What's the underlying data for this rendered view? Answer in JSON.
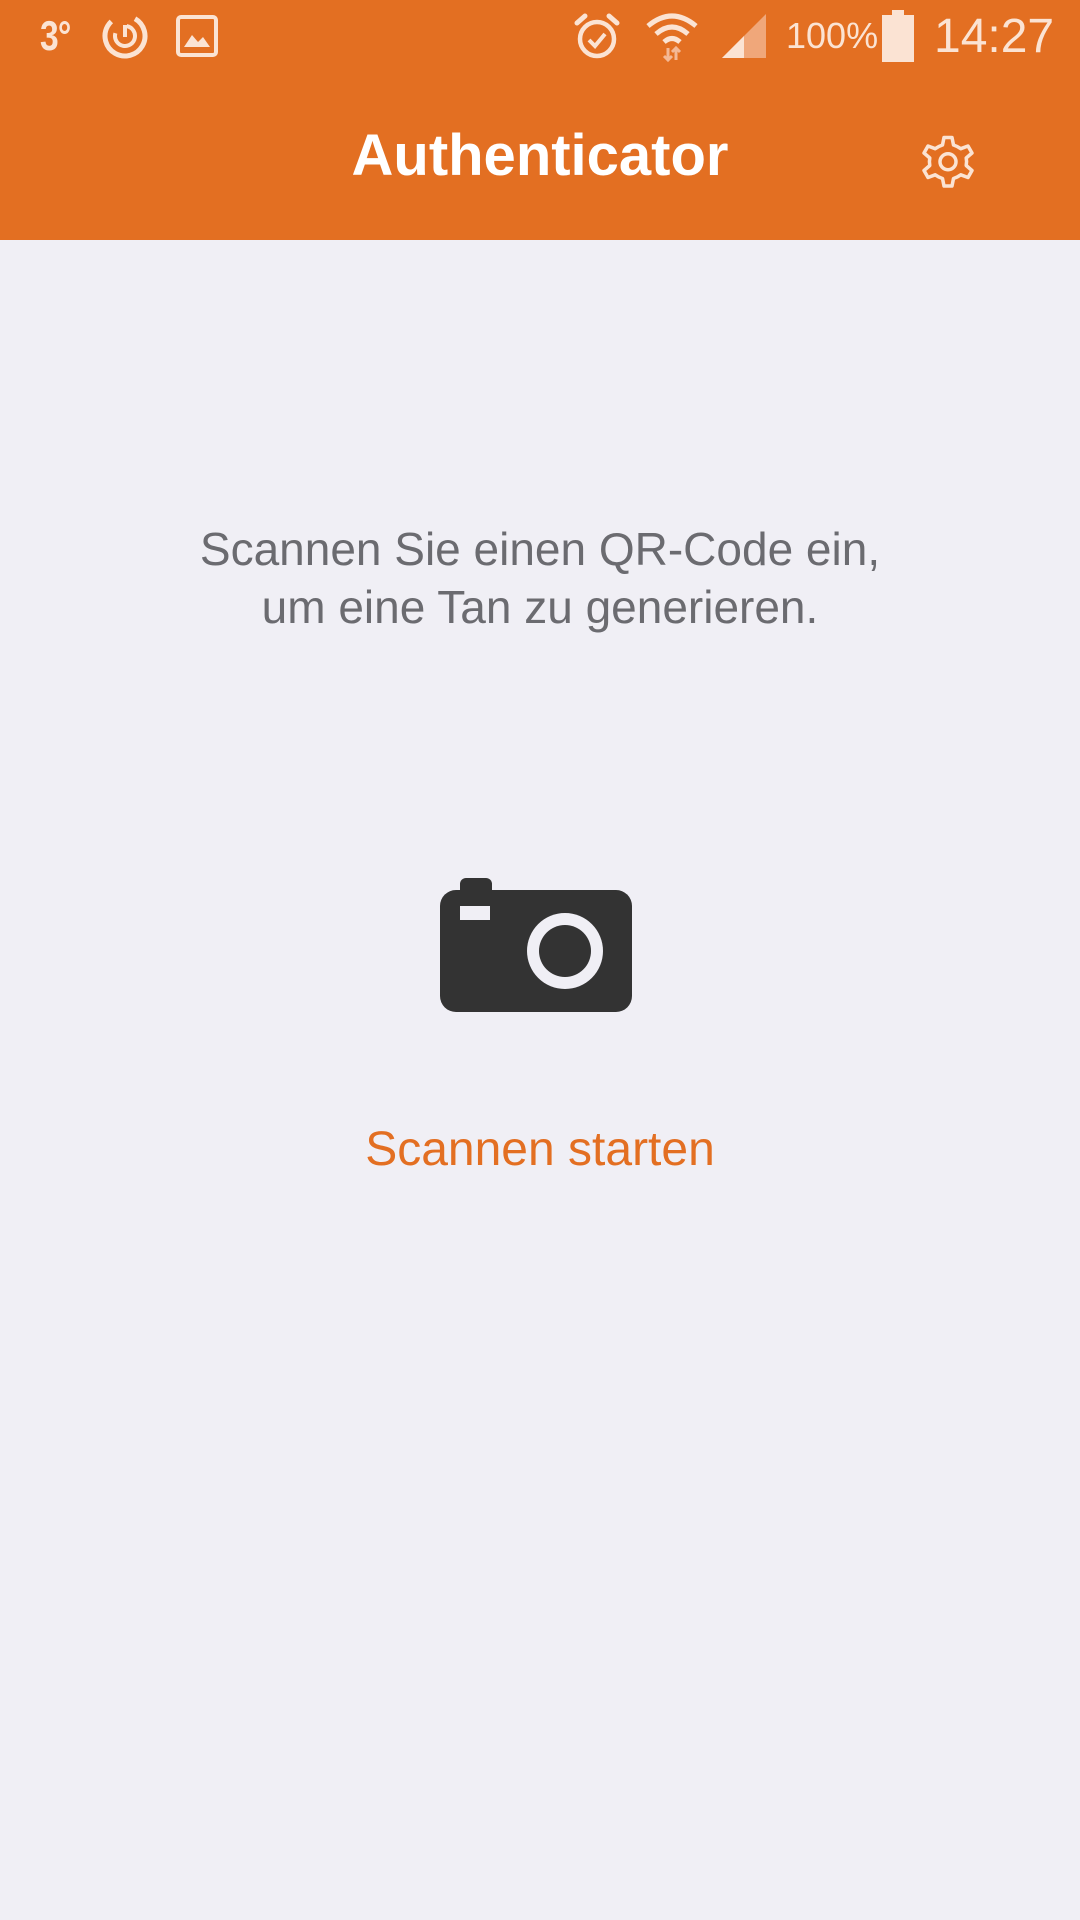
{
  "status_bar": {
    "temperature": "3°",
    "battery_percent": "100%",
    "time": "14:27",
    "icons": [
      "sync-icon",
      "image-icon",
      "alarm-icon",
      "wifi-icon",
      "signal-icon",
      "battery-icon"
    ]
  },
  "app_bar": {
    "title": "Authenticator",
    "settings_icon": "gear-icon"
  },
  "main": {
    "instruction_line1": "Scannen Sie einen QR-Code ein,",
    "instruction_line2": "um eine Tan zu generieren.",
    "camera_icon": "camera-icon",
    "scan_label": "Scannen starten"
  },
  "colors": {
    "accent": "#e36f22",
    "background": "#f0eff5",
    "text_secondary": "#6b6b70",
    "icon_dark": "#333333"
  }
}
